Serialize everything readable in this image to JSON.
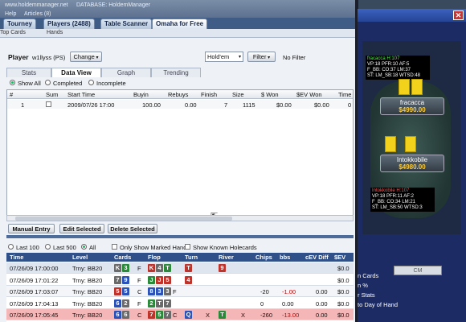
{
  "app": {
    "url": "www.holdemmanager.net",
    "database": "DATABASE: HoldemManager",
    "menu": [
      "Help",
      "Articles (8)"
    ]
  },
  "tabs": [
    "Tourney",
    "Players (2488)",
    "Table Scanner",
    "Omaha for Free"
  ],
  "subtabs": [
    "Top Cards",
    "Hands"
  ],
  "player": {
    "label": "Player",
    "name": "w1llyss (PS)",
    "change_label": "Change",
    "game": "Hold'em",
    "filter_label": "Filter",
    "filter_value": "No Filter"
  },
  "view_tabs": [
    "Stats",
    "Data View",
    "Graph",
    "Trending"
  ],
  "show_options": [
    "Show All",
    "Completed",
    "Incomplete"
  ],
  "grid1": {
    "headers": [
      "#",
      "Sum",
      "Start Time",
      "Buyin",
      "Rebuys",
      "Finish",
      "Size",
      "$ Won",
      "$EV Won",
      "Time"
    ],
    "rows": [
      {
        "num": "1",
        "start": "2009/07/26 17:00",
        "buyin": "100.00",
        "rebuys": "0.00",
        "finish": "7",
        "size": "1115",
        "won": "$0.00",
        "ev": "$0.00",
        "time": "0"
      }
    ]
  },
  "actions": [
    "Manual Entry",
    "Edit Selected",
    "Delete Selected"
  ],
  "hand_filter": {
    "options": [
      "Last 100",
      "Last 500",
      "All"
    ],
    "marked": "Only Show Marked Hands",
    "known": "Show Known Holecards"
  },
  "grid2": {
    "headers": [
      "Time",
      "Level",
      "Cards",
      "Flop",
      "Turn",
      "River",
      "Chips",
      "bbs",
      "cEV Diff",
      "$EV"
    ],
    "rows": [
      {
        "time": "07/26/09 17:00:00",
        "level": "Trny: BB20",
        "cards": [
          "K",
          "3"
        ],
        "pre": "F",
        "flop": [
          "K",
          "4",
          "T"
        ],
        "fa": "",
        "turn": "T",
        "ta": "",
        "river": "9",
        "ra": "",
        "chips": "",
        "bbs": "",
        "cev": "",
        "ev": "$0.0"
      },
      {
        "time": "07/26/09 17:01:22",
        "level": "Trny: BB20",
        "cards": [
          "7",
          "9"
        ],
        "pre": "F",
        "flop": [
          "J",
          "J",
          "5"
        ],
        "fa": "",
        "turn": "4",
        "ta": "",
        "river": "",
        "ra": "",
        "chips": "",
        "bbs": "",
        "cev": "",
        "ev": "$0.0"
      },
      {
        "time": "07/26/09 17:03:07",
        "level": "Trny: BB20",
        "cards": [
          "5",
          "5"
        ],
        "pre": "C",
        "flop": [
          "8",
          "3",
          "3"
        ],
        "fa": "F",
        "turn": "",
        "ta": "",
        "river": "",
        "ra": "",
        "chips": "-20",
        "bbs": "-1.00",
        "cev": "0.00",
        "ev": "$0.0"
      },
      {
        "time": "07/26/09 17:04:13",
        "level": "Trny: BB20",
        "cards": [
          "6",
          "2"
        ],
        "pre": "F",
        "flop": [
          "2",
          "T",
          "7"
        ],
        "fa": "",
        "turn": "",
        "ta": "",
        "river": "",
        "ra": "",
        "chips": "0",
        "bbs": "0.00",
        "cev": "0.00",
        "ev": "$0.0"
      },
      {
        "time": "07/26/09 17:05:45",
        "level": "Trny: BB20",
        "cards": [
          "6",
          "6"
        ],
        "pre": "C",
        "flop": [
          "7",
          "5",
          "7"
        ],
        "fa": "C",
        "turn": "Q",
        "ta": "X",
        "river": "T",
        "ra": "X",
        "chips": "-260",
        "bbs": "-13.00",
        "cev": "0.00",
        "ev": "$0.0"
      }
    ]
  },
  "table": {
    "player1": {
      "name": "fracacca",
      "stack": "$4990.00",
      "hud": [
        "fracacca H:107",
        "VP:18 PFR:10 AF:5",
        "F_BB: CO:37 LM:37",
        "ST: LM_SB:18 WTSD:48"
      ]
    },
    "player2": {
      "name": "Intokkobile",
      "stack": "$4980.00",
      "hud": [
        "Intokkobile H:107",
        "VP:18 PFR:11 AF:2",
        "F_BB: CO:34 LM:21",
        "ST: LM_SB:50 WTSD:3"
      ]
    }
  },
  "right_menu": {
    "items": [
      "n Cards",
      "n %",
      "r Stats",
      "to Day of Hand"
    ],
    "button": "CM"
  },
  "colors": {
    "accent": "#2f5089",
    "card_red": "#c0332b",
    "card_green": "#2a8a3a",
    "card_blue": "#2b52b8",
    "card_gray": "#6a6a6a",
    "row_selected": "#f4b6b6",
    "table_felt": "#2e4743"
  }
}
